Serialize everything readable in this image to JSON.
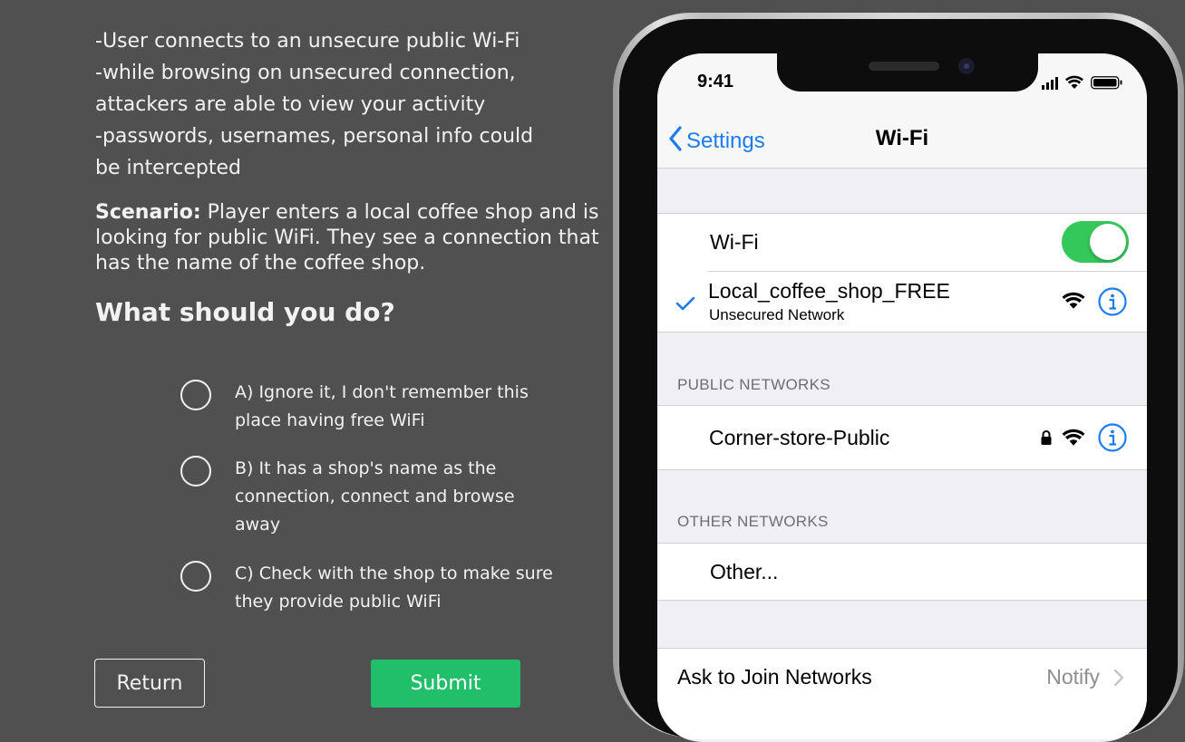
{
  "intro": {
    "lines": [
      "-User connects to an unsecure public Wi-Fi",
      "-while browsing on unsecured connection,",
      "attackers are able to view your activity",
      "-passwords, usernames, personal info could",
      "be intercepted"
    ]
  },
  "scenario": {
    "label": "Scenario:",
    "text": " Player enters a local coffee shop and is looking for public WiFi. They see a connection that has the name of the coffee shop."
  },
  "question": "What should you do?",
  "options": [
    {
      "line1": "A) Ignore it, I don't remember this",
      "line2": "place having free WiFi"
    },
    {
      "line1": "B) It has a shop's name as the",
      "line2": "connection, connect and browse",
      "line3": "away"
    },
    {
      "line1": "C) Check with the shop to make sure",
      "line2": "they provide public WiFi"
    }
  ],
  "buttons": {
    "return": "Return",
    "submit": "Submit"
  },
  "phone": {
    "time": "9:41",
    "back_label": "Settings",
    "title": "Wi-Fi",
    "wifi_label": "Wi-Fi",
    "wifi_enabled": true,
    "connected": {
      "name": "Local_coffee_shop_FREE",
      "status": "Unsecured Network"
    },
    "public_header": "PUBLIC NETWORKS",
    "public_networks": [
      {
        "name": "Corner-store-Public",
        "locked": true
      }
    ],
    "other_header": "OTHER NETWORKS",
    "other_label": "Other...",
    "ask_label": "Ask to Join Networks",
    "ask_value": "Notify"
  },
  "colors": {
    "background": "#505050",
    "submit": "#22bf6b",
    "ios_blue": "#1b7cf2",
    "toggle_on": "#34c759"
  },
  "icons": [
    "chevron-left-icon",
    "checkmark-icon",
    "wifi-icon",
    "info-icon",
    "lock-icon",
    "chevron-right-icon",
    "signal-icon",
    "battery-icon"
  ]
}
